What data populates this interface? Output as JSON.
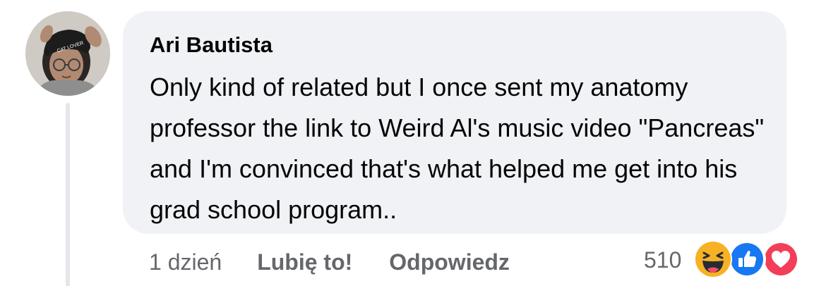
{
  "comment": {
    "author": "Ari Bautista",
    "text": "Only kind of related but I once sent my anatomy professor the link to Weird Al's music video \"Pancreas\" and I'm convinced that's what helped me get into his grad school program..",
    "avatar_hat_text": "CAT LOVER"
  },
  "actions": {
    "time": "1 dzień",
    "like_label": "Lubię to!",
    "reply_label": "Odpowiedz"
  },
  "reactions": {
    "count": "510",
    "icons": [
      "haha-icon",
      "like-icon",
      "love-icon"
    ],
    "colors": {
      "haha": "#f7b125",
      "like": "#1877f2",
      "love": "#f33e58"
    }
  },
  "colors": {
    "bubble_background": "#f0f2f5",
    "secondary_text": "#65676b",
    "primary_text": "#050505"
  }
}
